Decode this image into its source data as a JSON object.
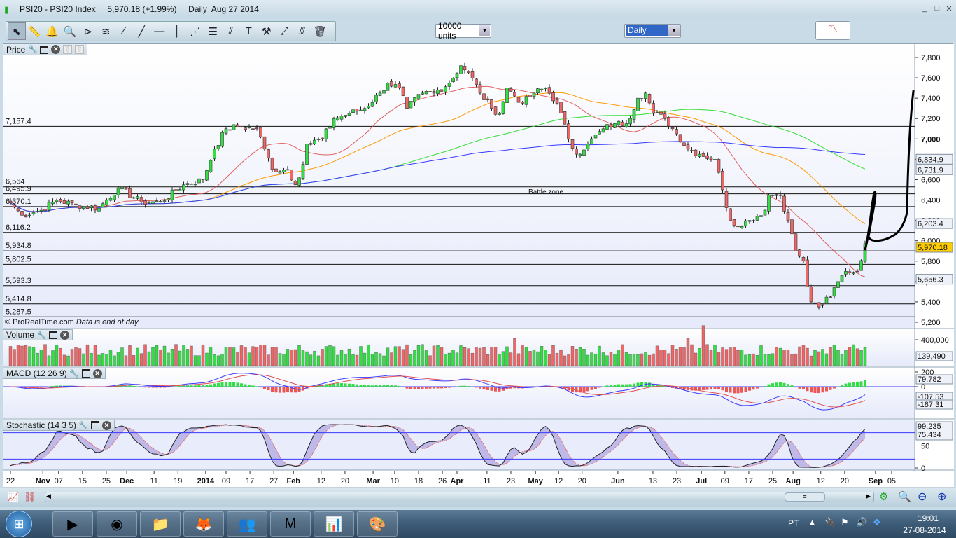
{
  "window": {
    "title": "PSI20 - PSI20 Index",
    "price": "5,970.18 (+1.99%)",
    "period": "Daily",
    "date": "Aug 27 2014",
    "min": "_",
    "max": "□",
    "close": "✕"
  },
  "toolbar": {
    "icons": [
      "pointer-icon",
      "ruler-icon",
      "alarm-bell-icon",
      "zoom-magnifier-icon",
      "triangle-pattern-icon",
      "channel-icon",
      "segment-icon",
      "line-icon",
      "horizontal-line-icon",
      "vertical-line-icon",
      "fibonacci-fan-icon",
      "fibonacci-retracement-icon",
      "trend-channel-icon",
      "text-icon",
      "tools-icon",
      "point-icon",
      "parallel-line-icon",
      "trash-icon"
    ],
    "glyphs": [
      "⬉",
      "📏",
      "🔔",
      "🔍",
      "⊳",
      "≋",
      "⁄",
      "╱",
      "—",
      "│",
      "⋰",
      "☰",
      "⫽",
      "T",
      "⚒",
      "⤢",
      "⫻",
      "🗑"
    ],
    "units": "10000 units",
    "timeframe": "Daily"
  },
  "panels": {
    "price": "Price",
    "volume": "Volume",
    "macd": "MACD (12 26 9)",
    "stochastic": "Stochastic (14 3 5)",
    "copyright": "© ProRealTime.com",
    "eod": "Data is end of day",
    "annotation": "Battle zone"
  },
  "levels": [
    {
      "label": "7,157.4",
      "value": 7157.4
    },
    {
      "label": "6,564",
      "value": 6564
    },
    {
      "label": "6,495.9",
      "value": 6495.9
    },
    {
      "label": "6,370.1",
      "value": 6370.1
    },
    {
      "label": "6,116.2",
      "value": 6116.2
    },
    {
      "label": "5,934.8",
      "value": 5934.8
    },
    {
      "label": "5,802.5",
      "value": 5802.5
    },
    {
      "label": "5,593.3",
      "value": 5593.3
    },
    {
      "label": "5,414.8",
      "value": 5414.8
    },
    {
      "label": "5,287.5",
      "value": 5287.5
    }
  ],
  "price_axis": [
    "7,800",
    "7,600",
    "7,400",
    "7,200",
    "7,000",
    "6,800",
    "6,600",
    "6,400",
    "6,200",
    "6,000",
    "5,800",
    "5,600",
    "5,400",
    "5,200"
  ],
  "price_tags": [
    {
      "label": "6,834.9",
      "value": 6834.9,
      "color": "#3a3aff"
    },
    {
      "label": "6,731.9",
      "value": 6731.9,
      "color": "#33dd33"
    },
    {
      "label": "6,203.4",
      "value": 6203.4,
      "color": "#ff9900"
    },
    {
      "label": "5,970.18",
      "value": 5970.18,
      "color": "#000000",
      "bg": "#ffcc00"
    },
    {
      "label": "5,656.3",
      "value": 5656.3,
      "color": "#e05050"
    }
  ],
  "volume_axis": {
    "label": "400,000",
    "tag": "139,490",
    "tag_color": "#33cc33"
  },
  "macd_axis": {
    "top": "200",
    "zero": "0",
    "tag1": "79.782",
    "tag1_color": "#33cc33",
    "tag2": "-107.53",
    "tag2_color": "#3a3aff",
    "tag3": "-187.31",
    "tag3_color": "#e05050"
  },
  "stoch_axis": {
    "mid": "50",
    "zero": "0",
    "tag1": "99.235",
    "tag2": "75.434",
    "tag2_color": "#e05050"
  },
  "chart_data": {
    "type": "candlestick",
    "title": "PSI20 - PSI20 Index Daily",
    "approx_closes": [
      [
        0,
        6370
      ],
      [
        3,
        6250
      ],
      [
        8,
        6300
      ],
      [
        12,
        6400
      ],
      [
        17,
        6350
      ],
      [
        23,
        6320
      ],
      [
        28,
        6520
      ],
      [
        34,
        6380
      ],
      [
        39,
        6380
      ],
      [
        45,
        6550
      ],
      [
        50,
        6600
      ],
      [
        53,
        6900
      ],
      [
        56,
        7100
      ],
      [
        59,
        7120
      ],
      [
        64,
        7100
      ],
      [
        66,
        6900
      ],
      [
        68,
        6700
      ],
      [
        72,
        6700
      ],
      [
        74,
        6550
      ],
      [
        76,
        6750
      ],
      [
        77,
        6950
      ],
      [
        81,
        7000
      ],
      [
        84,
        7200
      ],
      [
        88,
        7250
      ],
      [
        92,
        7300
      ],
      [
        96,
        7450
      ],
      [
        98,
        7550
      ],
      [
        101,
        7500
      ],
      [
        103,
        7300
      ],
      [
        107,
        7450
      ],
      [
        110,
        7450
      ],
      [
        114,
        7550
      ],
      [
        117,
        7720
      ],
      [
        119,
        7650
      ],
      [
        122,
        7450
      ],
      [
        125,
        7300
      ],
      [
        127,
        7250
      ],
      [
        129,
        7500
      ],
      [
        133,
        7350
      ],
      [
        136,
        7450
      ],
      [
        139,
        7500
      ],
      [
        142,
        7350
      ],
      [
        145,
        7000
      ],
      [
        147,
        6850
      ],
      [
        150,
        6950
      ],
      [
        154,
        7100
      ],
      [
        157,
        7150
      ],
      [
        160,
        7150
      ],
      [
        163,
        7400
      ],
      [
        165,
        7450
      ],
      [
        167,
        7250
      ],
      [
        170,
        7200
      ],
      [
        173,
        7050
      ],
      [
        176,
        6900
      ],
      [
        179,
        6850
      ],
      [
        183,
        6800
      ],
      [
        185,
        6500
      ],
      [
        187,
        6200
      ],
      [
        188,
        6150
      ],
      [
        192,
        6200
      ],
      [
        196,
        6300
      ],
      [
        197,
        6450
      ],
      [
        200,
        6450
      ],
      [
        202,
        6200
      ],
      [
        204,
        5900
      ],
      [
        206,
        5800
      ],
      [
        207,
        5550
      ],
      [
        208,
        5400
      ],
      [
        210,
        5350
      ],
      [
        213,
        5450
      ],
      [
        215,
        5600
      ],
      [
        217,
        5700
      ],
      [
        220,
        5700
      ],
      [
        222,
        5970.18
      ]
    ],
    "ylim": [
      5200,
      7800
    ],
    "x_ticks": [
      {
        "label": "22",
        "bar": 0
      },
      {
        "label": "Nov",
        "bar": 8.4,
        "bold": true
      },
      {
        "label": "07",
        "bar": 12.5
      },
      {
        "label": "15",
        "bar": 18.7
      },
      {
        "label": "25",
        "bar": 24.9
      },
      {
        "label": "Dec",
        "bar": 30.2,
        "bold": true
      },
      {
        "label": "11",
        "bar": 37.3
      },
      {
        "label": "19",
        "bar": 43.5
      },
      {
        "label": "2014",
        "bar": 50.7,
        "bold": true
      },
      {
        "label": "09",
        "bar": 56
      },
      {
        "label": "17",
        "bar": 62.2
      },
      {
        "label": "27",
        "bar": 68.4
      },
      {
        "label": "Feb",
        "bar": 73.5,
        "bold": true
      },
      {
        "label": "12",
        "bar": 80.7
      },
      {
        "label": "20",
        "bar": 86.9
      },
      {
        "label": "Mar",
        "bar": 94.2,
        "bold": true
      },
      {
        "label": "10",
        "bar": 99.8
      },
      {
        "label": "18",
        "bar": 106
      },
      {
        "label": "26",
        "bar": 112.2
      },
      {
        "label": "Apr",
        "bar": 116,
        "bold": true
      },
      {
        "label": "11",
        "bar": 123.8
      },
      {
        "label": "23",
        "bar": 130
      },
      {
        "label": "May",
        "bar": 136.4,
        "bold": true
      },
      {
        "label": "12",
        "bar": 142.4
      },
      {
        "label": "20",
        "bar": 148.5
      },
      {
        "label": "Jun",
        "bar": 157.8,
        "bold": true
      },
      {
        "label": "13",
        "bar": 166.9
      },
      {
        "label": "23",
        "bar": 173.1
      },
      {
        "label": "Jul",
        "bar": 179.5,
        "bold": true
      },
      {
        "label": "09",
        "bar": 185.6
      },
      {
        "label": "17",
        "bar": 191.8
      },
      {
        "label": "25",
        "bar": 198
      },
      {
        "label": "Aug",
        "bar": 203.3,
        "bold": true
      },
      {
        "label": "12",
        "bar": 210.5
      },
      {
        "label": "20",
        "bar": 216.7
      },
      {
        "label": "Sep",
        "bar": 224.7,
        "bold": true
      },
      {
        "label": "05",
        "bar": 228.9
      }
    ],
    "moving_averages": [
      {
        "period": 20,
        "color": "#e06060"
      },
      {
        "period": 50,
        "color": "#ff9900"
      },
      {
        "period": 100,
        "color": "#33dd33"
      },
      {
        "period": 200,
        "color": "#3a3aff"
      }
    ]
  },
  "taskbar": {
    "apps": [
      "media-player",
      "chrome",
      "file-explorer",
      "firefox",
      "messenger",
      "mcafee",
      "prorealtime",
      "paint"
    ],
    "glyphs": [
      "▶",
      "◉",
      "📁",
      "🦊",
      "👥",
      "M",
      "📊",
      "🎨"
    ],
    "lang": "PT",
    "time": "19:01",
    "date": "27-08-2014"
  }
}
